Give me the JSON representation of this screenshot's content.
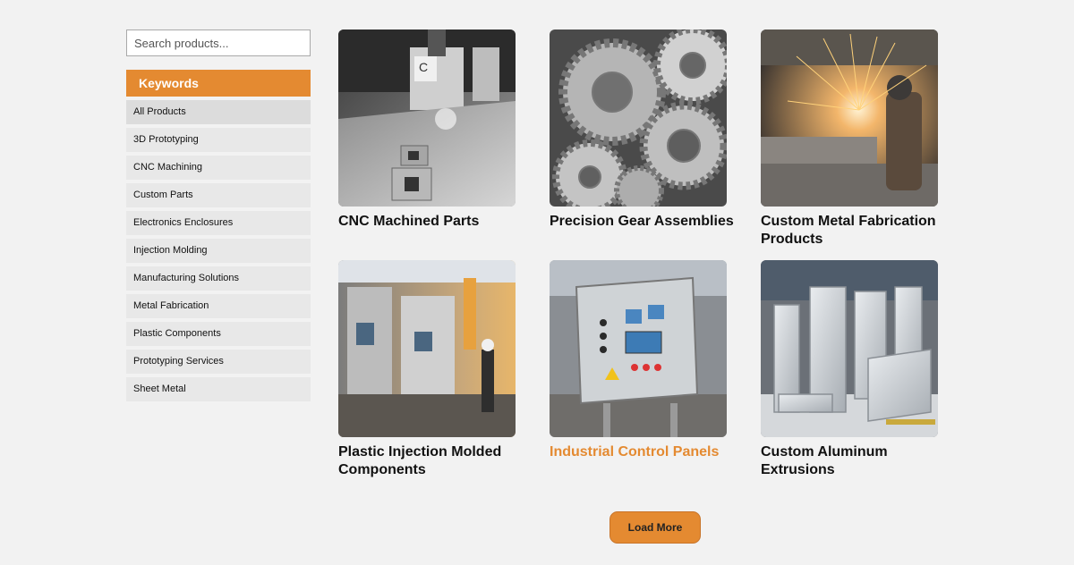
{
  "search": {
    "placeholder": "Search products..."
  },
  "keywords": {
    "title": "Keywords",
    "items": [
      "All Products",
      "3D Prototyping",
      "CNC Machining",
      "Custom Parts",
      "Electronics Enclosures",
      "Injection Molding",
      "Manufacturing Solutions",
      "Metal Fabrication",
      "Plastic Components",
      "Prototyping Services",
      "Sheet Metal"
    ],
    "active_index": 0
  },
  "products": [
    {
      "title": "CNC Machined Parts",
      "image": "cnc-machine-photo"
    },
    {
      "title": "Precision Gear Assemblies",
      "image": "gears-photo"
    },
    {
      "title": "Custom Metal Fabrication Products",
      "image": "welding-sparks-photo"
    },
    {
      "title": "Plastic Injection Molded Components",
      "image": "factory-line-photo"
    },
    {
      "title": "Industrial Control Panels",
      "image": "control-panel-photo"
    },
    {
      "title": "Custom Aluminum Extrusions",
      "image": "aluminum-extrusions-photo"
    }
  ],
  "load_more": {
    "label": "Load More"
  },
  "colors": {
    "accent": "#e48a31",
    "background": "#f2f2f2",
    "keyword_item": "#e8e8e8"
  }
}
